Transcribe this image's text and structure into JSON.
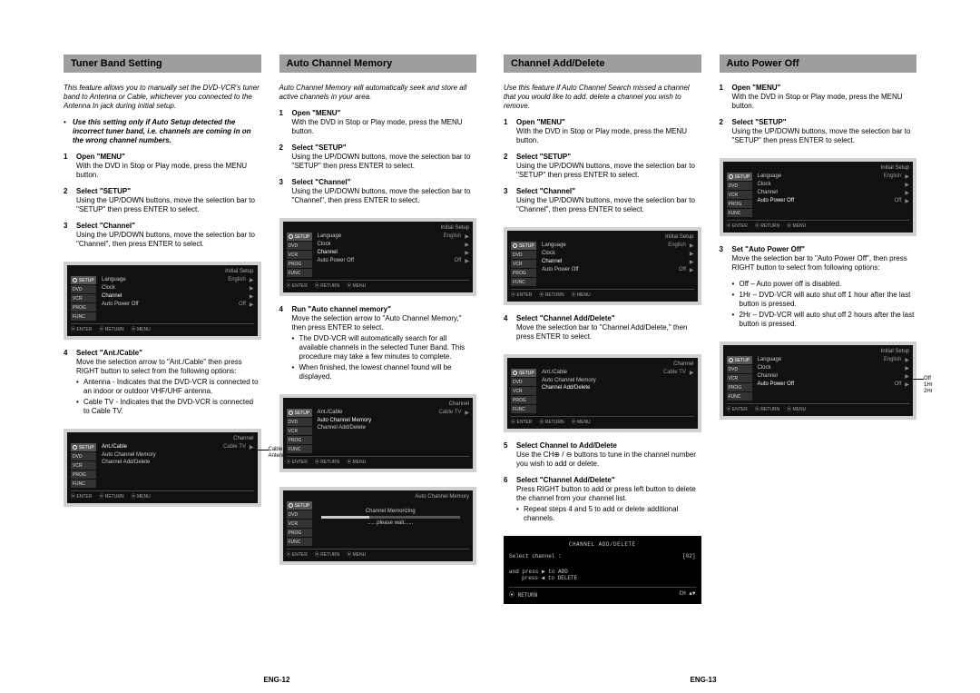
{
  "pageNumbers": {
    "left": "ENG-12",
    "right": "ENG-13"
  },
  "osd": {
    "titleInitial": "Initial Setup",
    "titleChannel": "Channel",
    "titleAutoMem": "Auto Channel Memory",
    "tabs": [
      "SETUP",
      "DVD",
      "VCR",
      "PROG",
      "FUNC"
    ],
    "rowsInitial": [
      {
        "k": "Language",
        "v": "English"
      },
      {
        "k": "Clock",
        "v": ""
      },
      {
        "k": "Channel",
        "v": ""
      },
      {
        "k": "Auto Power Off",
        "v": "Off"
      }
    ],
    "rowsChannel": [
      {
        "k": "Ant./Cable",
        "v": "Cable TV"
      },
      {
        "k": "Auto Channel Memory",
        "v": ""
      },
      {
        "k": "Channel Add/Delete",
        "v": ""
      }
    ],
    "footer": [
      "ENTER",
      "RETURN",
      "MENU"
    ],
    "memorizing": {
      "label": "Channel Memorizing",
      "wait": "......please  wait......"
    }
  },
  "callouts": {
    "cable_antenna": "Cable TV\nAntenna",
    "power_off_opts": "Off\n1Hr\n2Hr"
  },
  "col1": {
    "header": "Tuner Band Setting",
    "intro": "This feature allows you to manually set the DVD-VCR's tuner band to Antenna or Cable, whichever you connected to the Antenna In jack during initial setup.",
    "note": "Use this setting only if Auto Setup detected the incorrect tuner band, i.e. channels are coming in on the  wrong channel numbers.",
    "s1t": "Open \"MENU\"",
    "s1b": "With the DVD in Stop or Play mode, press the MENU button.",
    "s2t": "Select \"SETUP\"",
    "s2b": "Using the UP/DOWN  buttons, move the selection bar to \"SETUP\" then press ENTER to select.",
    "s3t": "Select \"Channel\"",
    "s3b": "Using the UP/DOWN buttons, move the selection bar to \"Channel\", then press ENTER to select.",
    "s4t": "Select \"Ant./Cable\"",
    "s4b": "Move the selection arrow to \"Ant./Cable\" then press RIGHT button to select from the following options:",
    "s4opt1": "Antenna - Indicates that the DVD-VCR is connected to an indoor or outdoor VHF/UHF antenna.",
    "s4opt2": "Cable TV - Indicates that the DVD-VCR is connected to Cable TV."
  },
  "col2": {
    "header": "Auto Channel Memory",
    "intro": "Auto Channel Memory will automatically seek and store all active channels in your area.",
    "s1t": "Open \"MENU\"",
    "s1b": "With the DVD in Stop or Play mode, press the MENU button.",
    "s2t": "Select \"SETUP\"",
    "s2b": "Using the UP/DOWN  buttons, move the selection bar to \"SETUP\" then press ENTER to select.",
    "s3t": "Select \"Channel\"",
    "s3b": "Using the UP/DOWN buttons, move the selection bar to \"Channel\", then press ENTER to select.",
    "s4t": "Run \"Auto channel memory\"",
    "s4b": "Move the selection arrow to \"Auto Channel Memory,\" then press ENTER to select.",
    "s4opt1": "The DVD-VCR will automatically search for all available channels in the selected Tuner Band. This procedure may take a few minutes to complete.",
    "s4opt2": "When finished, the lowest channel found will be displayed."
  },
  "col3": {
    "header": "Channel Add/Delete",
    "intro": "Use this feature if Auto Channel Search missed a channel that you would like to add, delete a channel you wish to remove.",
    "s1t": "Open \"MENU\"",
    "s1b": "With the DVD in Stop or Play mode, press the MENU button.",
    "s2t": "Select \"SETUP\"",
    "s2b": "Using the UP/DOWN  buttons, move the selection bar to \"SETUP\" then press ENTER to select.",
    "s3t": "Select \"Channel\"",
    "s3b": "Using the UP/DOWN buttons, move the selection bar to \"Channel\", then press ENTER to select.",
    "s4t": "Select \"Channel Add/Delete\"",
    "s4b": "Move the selection bar to \"Channel Add/Delete,\" then press ENTER to select.",
    "s5t": "Select Channel to Add/Delete",
    "s5b": "Use the CH⊕ / ⊖ buttons to tune in the channel number you wish to add or delete.",
    "s6t": "Select \"Channel Add/Delete\"",
    "s6b": "Press RIGHT button to add or press left button to delete the channel from your channel list.",
    "s6opt": "Repeat steps 4 and 5 to add or delete additional channels.",
    "chanScreen": {
      "title": "CHANNEL  ADD/DELETE",
      "select": "Select channel :",
      "num": "[02]",
      "line1": "and  press  ▶  to   ADD",
      "line2": "press   ◀  to   DELETE",
      "ret": "⦿ RETURN",
      "ch": "CH ▲▼"
    }
  },
  "col4": {
    "header": "Auto Power Off",
    "s1t": "Open \"MENU\"",
    "s1b": "With the DVD in Stop or Play mode, press the MENU button.",
    "s2t": "Select \"SETUP\"",
    "s2b": "Using the UP/DOWN buttons, move the selection bar to \"SETUP\" then press ENTER to select.",
    "s3t": "Set \"Auto Power Off\"",
    "s3b": "Move the selection bar to \"Auto Power Off\", then press RIGHT button to select from following options:",
    "opt1": "Off  –  Auto power off is disabled.",
    "opt2": "1Hr –  DVD-VCR will auto shut off 1 hour after the last button is pressed.",
    "opt3": "2Hr –  DVD-VCR will auto shut off 2 hours after the last button is  pressed."
  }
}
